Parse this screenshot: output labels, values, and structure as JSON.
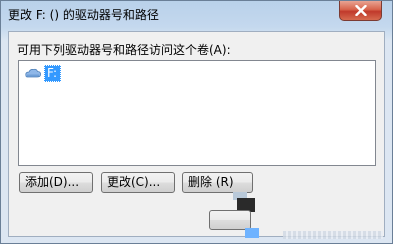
{
  "window": {
    "title": "更改 F: () 的驱动器号和路径"
  },
  "dialog": {
    "label": "可用下列驱动器号和路径访问这个卷(A):",
    "list": {
      "items": [
        {
          "label": "F:",
          "icon": "drive-icon",
          "selected": true
        }
      ]
    },
    "buttons": {
      "add": "添加(D)...",
      "change": "更改(C)...",
      "delete": "删除 (R)"
    }
  },
  "colors": {
    "selection": "#3399ff",
    "close_button": "#c0392b",
    "title_bar": "#b9d1ea"
  }
}
